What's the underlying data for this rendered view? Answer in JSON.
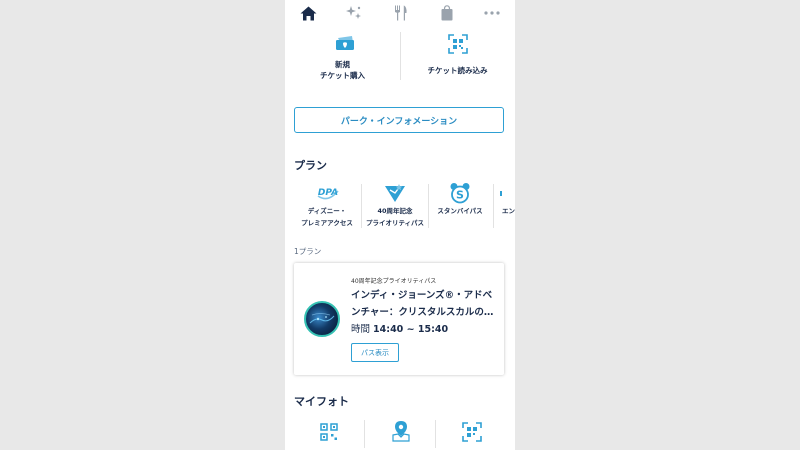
{
  "nav": {
    "items": [
      "home-icon",
      "sparkle-icon",
      "restaurant-icon",
      "shopping-bag-icon",
      "more-icon"
    ]
  },
  "quick": {
    "buy_ticket_line1": "新規",
    "buy_ticket_line2": "チケット購入",
    "scan_ticket": "チケット読み込み"
  },
  "park_info_button": "パーク・インフォメーション",
  "plans_section": {
    "title": "プラン",
    "items": [
      {
        "icon_text": "DPA",
        "line1": "ディズニー・",
        "line2": "プレミアアクセス"
      },
      {
        "icon_text": "",
        "line1": "40周年記念",
        "line2": "プライオリティパス"
      },
      {
        "icon_text": "S",
        "line1": "スタンバイパス",
        "line2": ""
      },
      {
        "icon_text": "",
        "line1": "エン",
        "line2": ""
      }
    ]
  },
  "plan_count": "1プラン",
  "plan_card": {
    "subtitle": "40周年記念プライオリティパス",
    "title": "インディ・ジョーンズ®・アドベンチャー：クリスタルスカルの…",
    "time_label": "時間",
    "time_value": "14:40 ~ 15:40",
    "button_label": "パス表示"
  },
  "photos_section": {
    "title": "マイフォト"
  },
  "colors": {
    "accent": "#2ea0d4",
    "navy": "#1a2b4a",
    "icon_gray": "#9aa3ad"
  }
}
